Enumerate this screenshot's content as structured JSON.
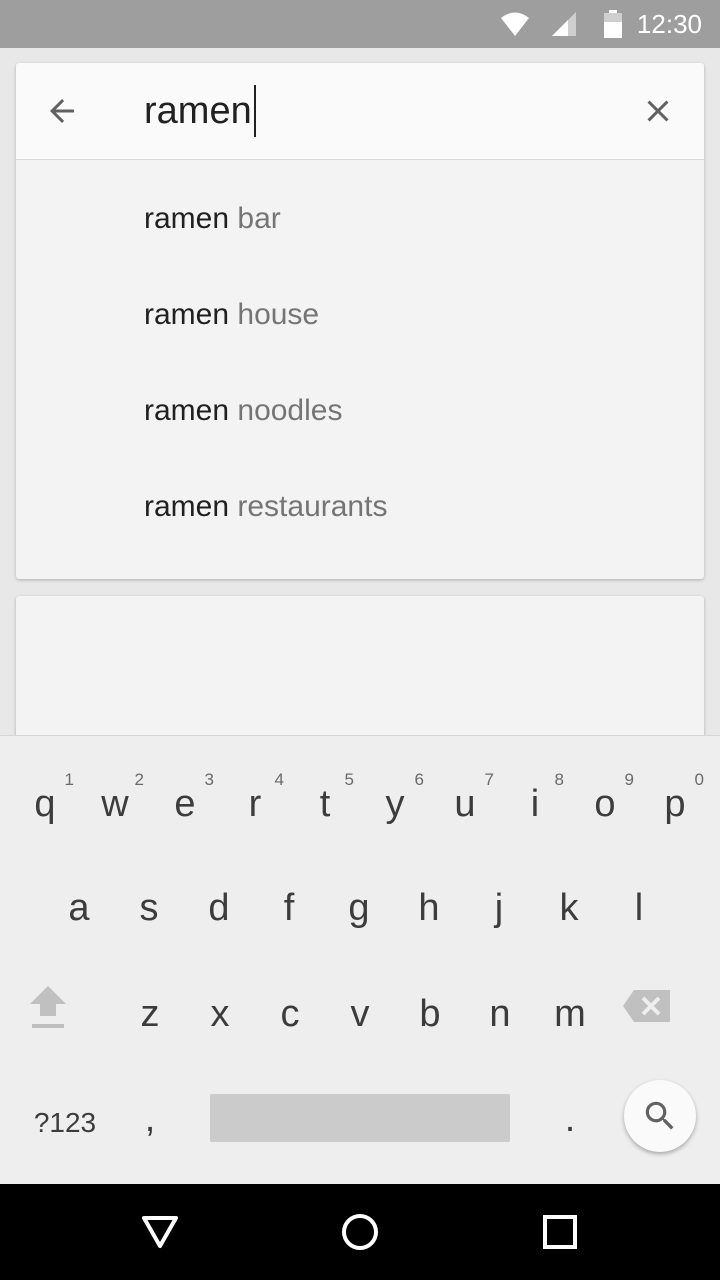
{
  "status_bar": {
    "time": "12:30",
    "icons": [
      "wifi-icon",
      "signal-icon",
      "battery-icon"
    ]
  },
  "search": {
    "query": "ramen",
    "back_icon": "arrow-back-icon",
    "clear_icon": "close-icon"
  },
  "suggestions": [
    {
      "query": "ramen",
      "completion": " bar"
    },
    {
      "query": "ramen",
      "completion": " house"
    },
    {
      "query": "ramen",
      "completion": " noodles"
    },
    {
      "query": "ramen",
      "completion": " restaurants"
    }
  ],
  "keyboard": {
    "row1": [
      {
        "key": "q",
        "hint": "1"
      },
      {
        "key": "w",
        "hint": "2"
      },
      {
        "key": "e",
        "hint": "3"
      },
      {
        "key": "r",
        "hint": "4"
      },
      {
        "key": "t",
        "hint": "5"
      },
      {
        "key": "y",
        "hint": "6"
      },
      {
        "key": "u",
        "hint": "7"
      },
      {
        "key": "i",
        "hint": "8"
      },
      {
        "key": "o",
        "hint": "9"
      },
      {
        "key": "p",
        "hint": "0"
      }
    ],
    "row2": [
      "a",
      "s",
      "d",
      "f",
      "g",
      "h",
      "j",
      "k",
      "l"
    ],
    "row3": [
      "z",
      "x",
      "c",
      "v",
      "b",
      "n",
      "m"
    ],
    "symbols_label": "?123",
    "comma_label": ",",
    "period_label": "."
  },
  "colors": {
    "status_bar": "#9e9e9e",
    "card": "#f2f3f2",
    "keyboard": "#eeeeee",
    "nav_bar": "#000000"
  }
}
